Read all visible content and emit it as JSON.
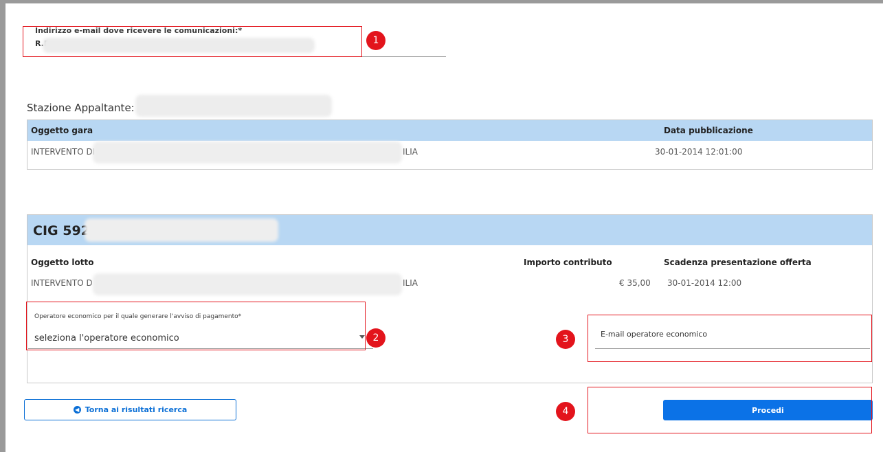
{
  "email_section": {
    "label": "Indirizzo e-mail dove ricevere le comunicazioni:*",
    "value": "R.R"
  },
  "stazione": {
    "label": "Stazione Appaltante: R"
  },
  "gara_table": {
    "headers": [
      "Oggetto gara",
      "Data pubblicazione"
    ],
    "row": {
      "oggetto_start": "INTERVENTO DI S",
      "oggetto_end": "ILIA",
      "data": "30-01-2014 12:01:00"
    }
  },
  "cig_panel": {
    "title": "CIG 5921",
    "headers": [
      "Oggetto lotto",
      "Importo contributo",
      "Scadenza presentazione offerta"
    ],
    "row": {
      "oggetto_start": "INTERVENTO D",
      "oggetto_end": "ILIA",
      "importo": "€ 35,00",
      "scadenza": "30-01-2014 12:00"
    }
  },
  "operatore": {
    "label": "Operatore economico per il quale generare l'avviso di pagamento*",
    "selected": "seleziona l'operatore economico"
  },
  "eo_email": {
    "label": "E-mail operatore economico"
  },
  "buttons": {
    "back": "Torna ai risultati ricerca",
    "procedi": "Procedi"
  },
  "annotations": [
    "1",
    "2",
    "3",
    "4"
  ],
  "colors": {
    "header_bg": "#b8d7f3",
    "primary": "#0b72e7",
    "annotation": "#e3141c"
  }
}
